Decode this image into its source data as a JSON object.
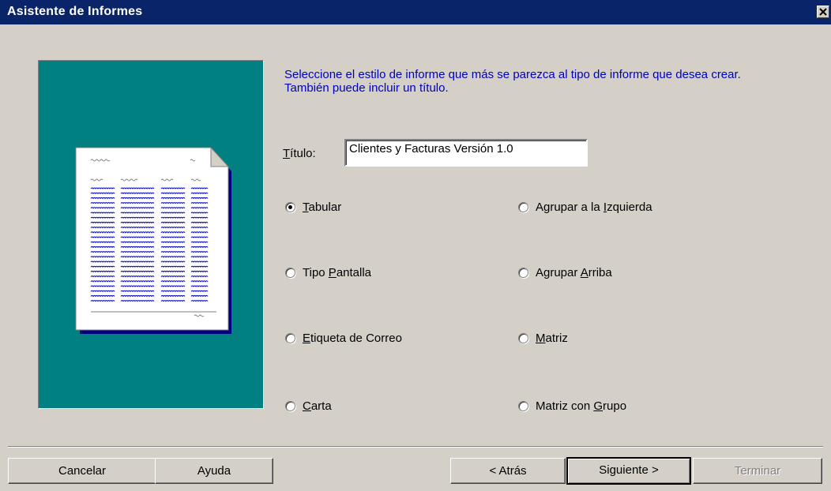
{
  "window": {
    "title": "Asistente de Informes"
  },
  "instructions": "Seleccione el estilo de informe que más se parezca al tipo de informe que desea crear. También puede incluir un título.",
  "title_field": {
    "label_accel": "T",
    "label_rest": "ítulo:",
    "value": "Clientes y Facturas Versión 1.0"
  },
  "styles": {
    "tabular": {
      "pre": "",
      "accel": "T",
      "post": "abular",
      "checked": true
    },
    "pantalla": {
      "pre": "Tipo ",
      "accel": "P",
      "post": "antalla",
      "checked": false
    },
    "etiqueta": {
      "pre": "",
      "accel": "E",
      "post": "tiqueta de Correo",
      "checked": false
    },
    "carta": {
      "pre": "",
      "accel": "C",
      "post": "arta",
      "checked": false
    },
    "izquierda": {
      "pre": "Agrupar a la ",
      "accel": "I",
      "post": "zquierda",
      "checked": false
    },
    "arriba": {
      "pre": "Agrupar ",
      "accel": "A",
      "post": "rriba",
      "checked": false
    },
    "matriz": {
      "pre": "",
      "accel": "M",
      "post": "atriz",
      "checked": false
    },
    "matriz_grupo": {
      "pre": "Matriz con ",
      "accel": "G",
      "post": "rupo",
      "checked": false
    }
  },
  "buttons": {
    "cancel": "Cancelar",
    "help": "Ayuda",
    "back": "< Atrás",
    "next": "Siguiente >",
    "finish": "Terminar"
  },
  "colors": {
    "titlebar": "#0a246a",
    "preview_bg": "#008080",
    "instructions": "#0000c0",
    "dialog": "#d4d0c8"
  }
}
